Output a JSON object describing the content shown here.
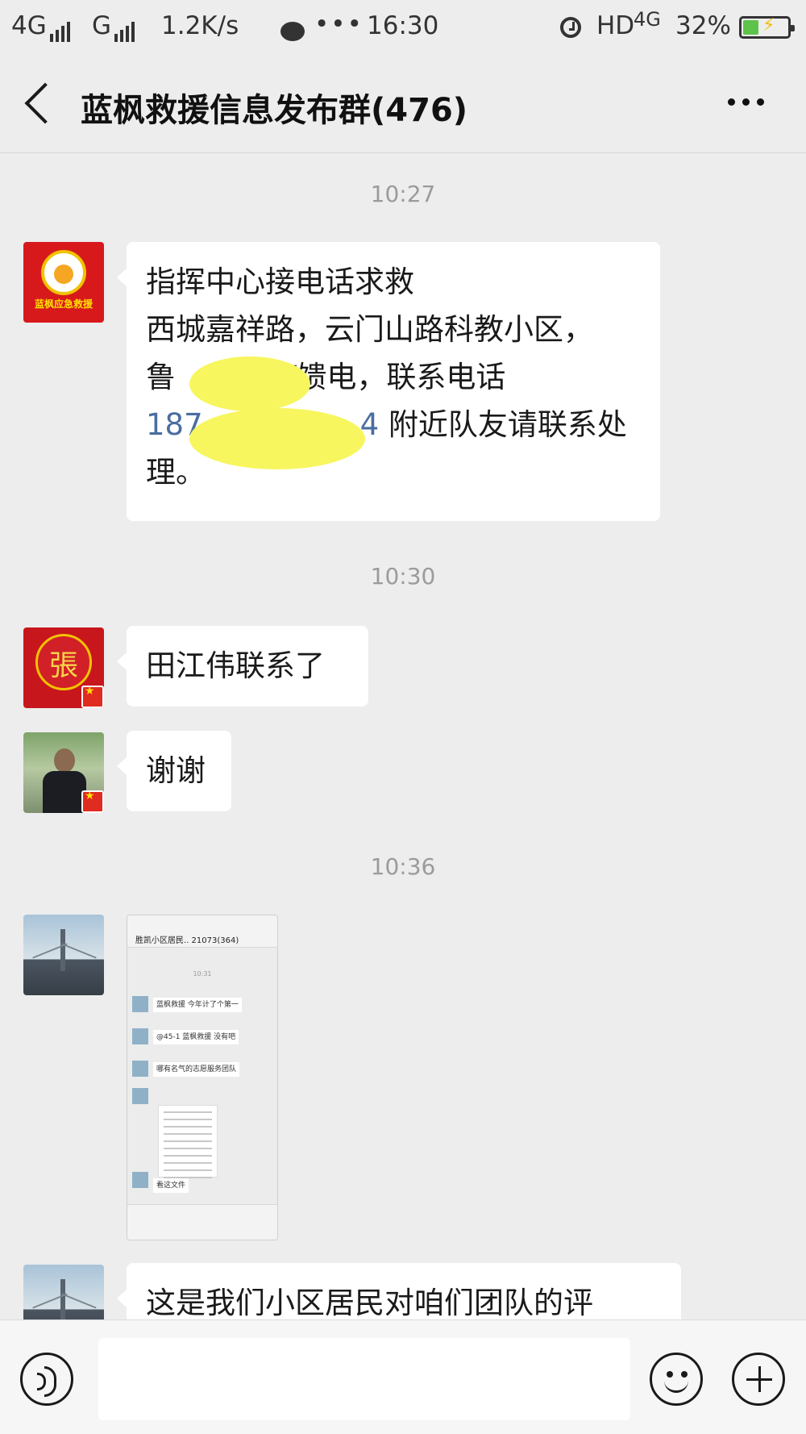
{
  "status_bar": {
    "network_left": "4G",
    "network_mid": "G",
    "speed": "1.2K/s",
    "more_dots": "•••",
    "clock": "16:30",
    "hd": "HD",
    "network_right": "4G",
    "battery_text": "32%",
    "battery_level": 0.32,
    "accent_color": "#5ec34a"
  },
  "header": {
    "title": "蓝枫救援信息发布群(476)"
  },
  "messages": {
    "time_1": "10:27",
    "msg1": {
      "avatar_text": "蓝枫应急救援",
      "line1": "指挥中心接电话求救",
      "line2": "西城嘉祥路，云门山路科教小区，",
      "line3_start": "鲁 ",
      "line3_end": "Y馈电，联系电话",
      "line4_phone_start": "187",
      "line4_phone_end": "4",
      "line4_rest": "附近队友请联系处",
      "line5": "理。"
    },
    "time_2": "10:30",
    "msg2": {
      "avatar_char": "張",
      "text": "田江伟联系了"
    },
    "msg3": {
      "text": "谢谢"
    },
    "time_3": "10:36",
    "msg4": {
      "thumb_title": "胜凯小区居民.. 21073(364)",
      "thumb_time": "10:31",
      "thumb_lines": [
        "蓝枫救援 今年计了个第一",
        "@45-1 蓝枫救援 没有吧",
        "哪有名气的志愿服务团队",
        "看这文件"
      ]
    },
    "msg5": {
      "text": "这是我们小区居民对咱们团队的评"
    }
  },
  "input_bar": {
    "placeholder": ""
  }
}
